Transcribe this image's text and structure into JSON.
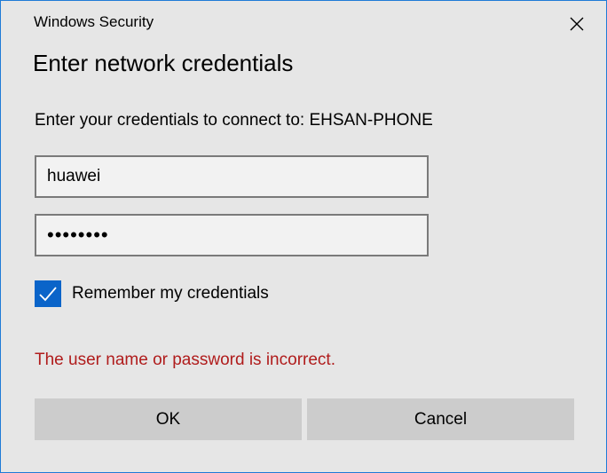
{
  "window": {
    "title": "Windows Security",
    "close_icon": "close-icon"
  },
  "dialog": {
    "heading": "Enter network credentials",
    "prompt": "Enter your credentials to connect to: EHSAN-PHONE"
  },
  "form": {
    "username_value": "huawei",
    "password_mask": "••••••••",
    "remember_label": "Remember my credentials",
    "remember_checked": true
  },
  "error": {
    "message": "The user name or password is incorrect."
  },
  "buttons": {
    "ok_label": "OK",
    "cancel_label": "Cancel"
  },
  "colors": {
    "accent": "#0a64c9",
    "error": "#b01c1c",
    "window_border": "#1f7bd6",
    "background": "#e6e6e6"
  }
}
